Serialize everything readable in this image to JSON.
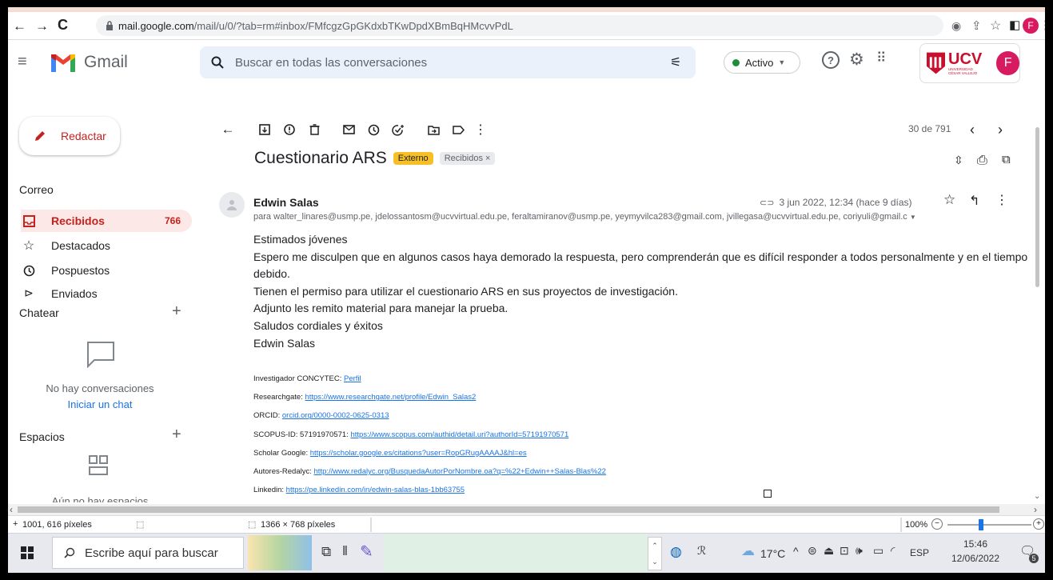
{
  "browser": {
    "url_host": "mail.google.com",
    "url_path": "/mail/u/0/?tab=rm#inbox/FMfcgzGpGKdxbTKwDpdXBmBqHMcvvPdL",
    "profile_initial": "F"
  },
  "gmail": {
    "logo_text": "Gmail",
    "search_placeholder": "Buscar en todas las conversaciones",
    "status_label": "Activo",
    "org_logo_text": "UCV",
    "org_logo_sub": "UNIVERSIDAD CÉSAR VALLEJO",
    "avatar_initial": "F"
  },
  "sidebar": {
    "compose_label": "Redactar",
    "mail_section": "Correo",
    "items": [
      {
        "label": "Recibidos",
        "count": "766"
      },
      {
        "label": "Destacados"
      },
      {
        "label": "Pospuestos"
      },
      {
        "label": "Enviados"
      }
    ],
    "chat_section": "Chatear",
    "no_conversations": "No hay conversaciones",
    "start_chat": "Iniciar un chat",
    "spaces_section": "Espacios",
    "no_spaces": "Aún no hay espacios"
  },
  "toolbar": {
    "pagination": "30 de 791"
  },
  "email": {
    "subject": "Cuestionario ARS",
    "chip_external": "Externo",
    "chip_inbox": "Recibidos ×",
    "sender": "Edwin Salas",
    "date": "3 jun 2022, 12:34 (hace 9 días)",
    "recipients": "para walter_linares@usmp.pe, jdelossantosm@ucvvirtual.edu.pe, feraltamiranov@usmp.pe, yeymyvilca283@gmail.com, jvillegasa@ucvvirtual.edu.pe, coriyuli@gmail.c",
    "body": [
      "Estimados jóvenes",
      "Espero me disculpen que en algunos casos haya demorado la respuesta, pero comprenderán que es difícil responder a todos personalmente y en el tiempo debido.",
      "Tienen el permiso para utilizar el cuestionario ARS en sus proyectos de investigación.",
      "Adjunto les remito material para manejar la prueba.",
      "Saludos cordiales y éxitos",
      "Edwin Salas"
    ],
    "links": [
      {
        "label": "Investigador CONCYTEC: ",
        "link": "Perfil"
      },
      {
        "label": "Researchgate: ",
        "link": "https://www.researchgate.net/profile/Edwin_Salas2"
      },
      {
        "label": "ORCID: ",
        "link": "orcid.org/0000-0002-0625-0313"
      },
      {
        "label": "SCOPUS-ID: 57191970571: ",
        "link": "https://www.scopus.com/authid/detail.uri?authorId=57191970571"
      },
      {
        "label": "Scholar Google: ",
        "link": "https://scholar.google.es/citations?user=RopGRugAAAAJ&hl=es"
      },
      {
        "label": "Autores-Redalyc: ",
        "link": "http://www.redalyc.org/BusquedaAutorPorNombre.oa?q=%22+Edwin++Salas-Blas%22"
      },
      {
        "label": "Linkedin: ",
        "link": "https://pe.linkedin.com/in/edwin-salas-blas-1bb63755"
      }
    ]
  },
  "status_bar": {
    "cursor_pos": "1001, 616 píxeles",
    "dimensions": "1366 × 768 píxeles",
    "zoom": "100%"
  },
  "taskbar": {
    "search_placeholder": "Escribe aquí para buscar",
    "temperature": "17°C",
    "language": "ESP",
    "time": "15:46",
    "date": "12/06/2022",
    "notification_count": "5"
  },
  "colors": {
    "gmail_red": "#ea4335",
    "selected_bg": "#fce8e6",
    "active_green": "#1e8e3e",
    "chip_yellow": "#f6bf26",
    "ucv_red": "#c8102e",
    "avatar_pink": "#d81b60"
  }
}
